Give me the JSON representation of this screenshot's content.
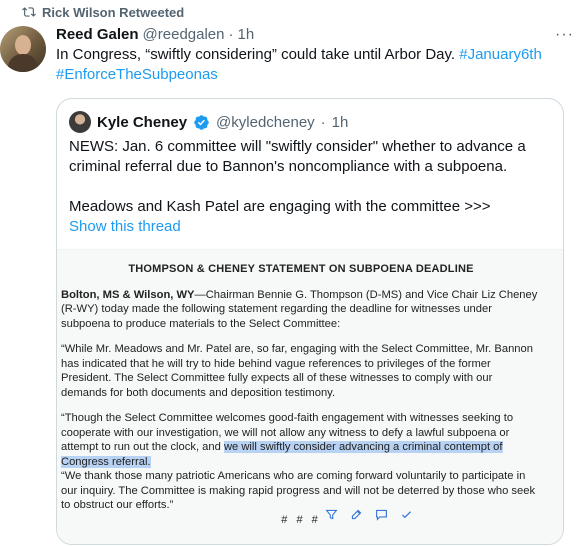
{
  "retweet": {
    "icon": "retweet-icon",
    "label": "Rick Wilson Retweeted"
  },
  "tweet": {
    "display_name": "Reed Galen",
    "handle": "@reedgalen",
    "sep": "·",
    "time": "1h",
    "more_icon": "more-icon",
    "text_main": "In Congress, “swiftly considering” could take until Arbor Day. ",
    "hashtag1": "#January6th",
    "hashtag2": "#EnforceTheSubpeonas"
  },
  "quote": {
    "display_name": "Kyle Cheney",
    "verified_icon": "verified-icon",
    "handle": "@kyledcheney",
    "sep": "·",
    "time": "1h",
    "line1": "NEWS: Jan. 6 committee will \"swiftly consider\" whether to advance a criminal referral due to Bannon's noncompliance with a subpoena.",
    "line2": "Meadows and Kash Patel are engaging with the committee >>>",
    "show_thread": "Show this thread"
  },
  "document": {
    "title": "THOMPSON & CHENEY STATEMENT ON SUBPOENA DEADLINE",
    "dateline": "Bolton, MS & Wilson, WY",
    "p1": "—Chairman Bennie G. Thompson (D-MS) and Vice Chair Liz Cheney (R-WY) today made the following statement regarding the deadline for witnesses under subpoena to produce materials to the Select Committee:",
    "p2": "“While Mr. Meadows and Mr. Patel are, so far, engaging with the Select Committee, Mr. Bannon has indicated that he will try to hide behind vague references to privileges of the former President. The Select Committee fully expects all of these witnesses to comply with our demands for both documents and deposition testimony.",
    "p3_a": "“Though the Select Committee welcomes good-faith engagement with witnesses seeking to cooperate with our investigation, we will not allow any witness to defy a lawful subpoena or attempt to run out the clock, and ",
    "p3_hl": "we will swiftly consider advancing a criminal contempt of Congress referral.",
    "p4": "“We thank those many patriotic Americans who are coming forward voluntarily to participate in our inquiry. The Committee is making rapid progress and will not be deterred by those who seek to obstruct our efforts.”",
    "footer": "# # #"
  },
  "selection_toolbar": {
    "icons": [
      "filter-icon",
      "edit-icon",
      "comment-icon",
      "check-icon"
    ]
  }
}
